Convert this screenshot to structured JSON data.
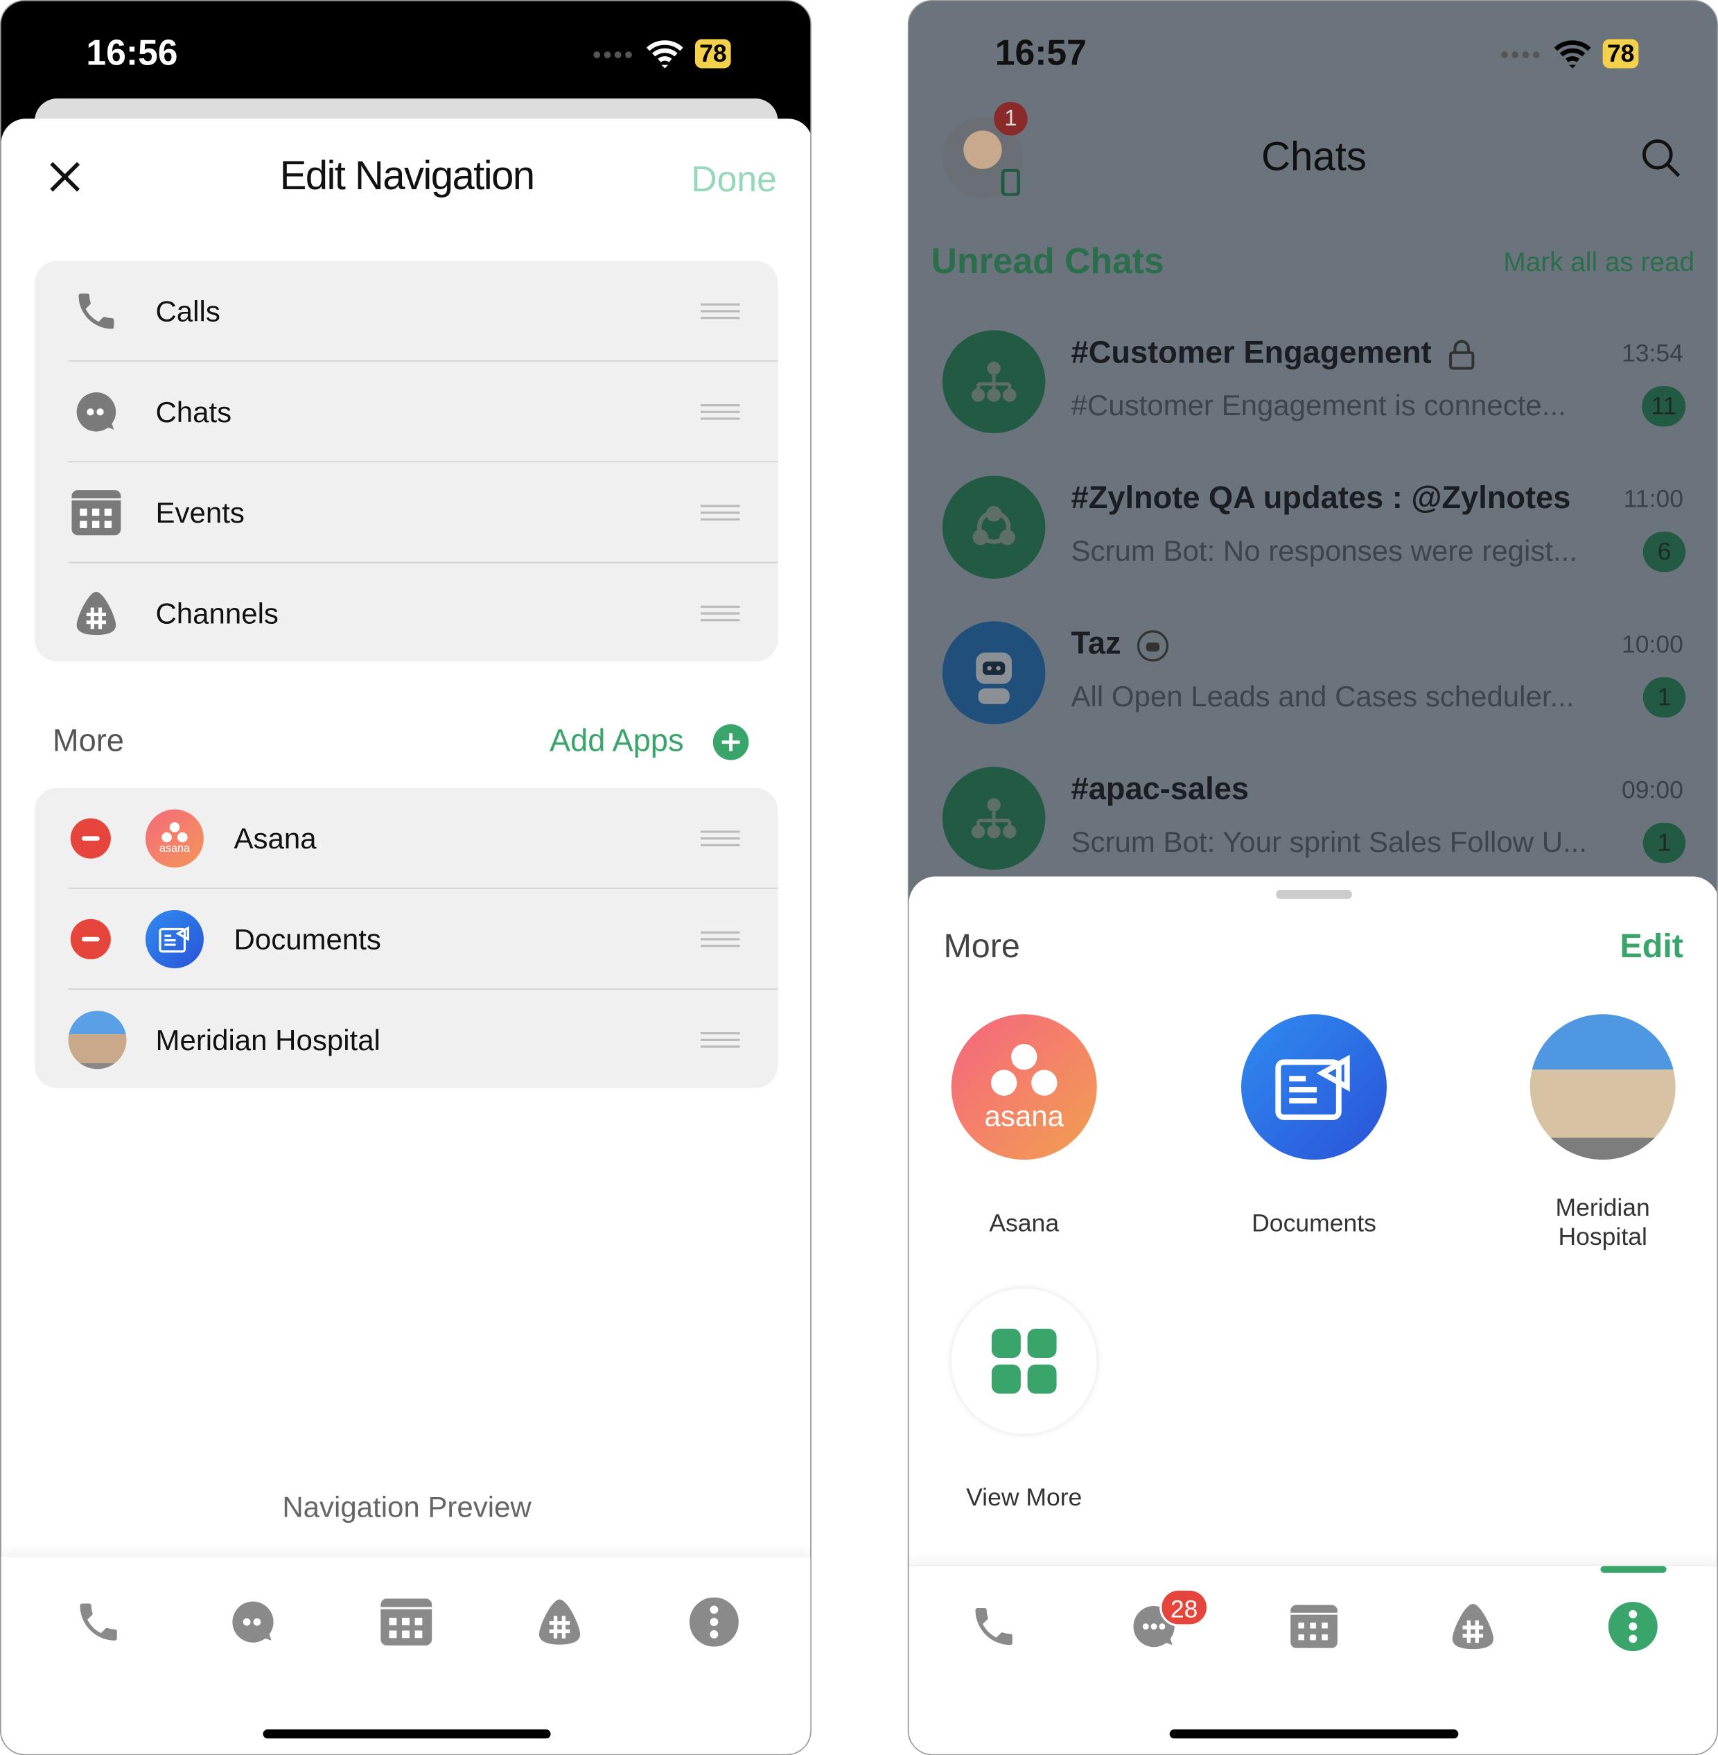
{
  "left": {
    "status": {
      "time": "16:56",
      "battery": "78"
    },
    "header": {
      "title": "Edit Navigation",
      "done": "Done"
    },
    "nav_items": [
      {
        "label": "Calls",
        "icon": "phone-icon"
      },
      {
        "label": "Chats",
        "icon": "chat-icon"
      },
      {
        "label": "Events",
        "icon": "calendar-icon"
      },
      {
        "label": "Channels",
        "icon": "channel-hash-icon"
      }
    ],
    "more": {
      "label": "More",
      "add_apps": "Add Apps",
      "items": [
        {
          "label": "Asana",
          "removable": true,
          "logo_text": "asana"
        },
        {
          "label": "Documents",
          "removable": true
        },
        {
          "label": "Meridian Hospital",
          "removable": false
        }
      ]
    },
    "preview_label": "Navigation Preview"
  },
  "right": {
    "status": {
      "time": "16:57",
      "battery": "78"
    },
    "header": {
      "title": "Chats",
      "avatar_badge": "1"
    },
    "section": {
      "title": "Unread Chats",
      "action": "Mark all as read"
    },
    "chats": [
      {
        "title": "#Customer Engagement",
        "time": "13:54",
        "preview": "#Customer Engagement is connecte...",
        "badge": "11",
        "icon": "org-icon",
        "locked": true
      },
      {
        "title": "#Zylnote QA updates : @Zylnotes",
        "time": "11:00",
        "preview": "Scrum Bot: No responses were regist...",
        "badge": "6",
        "icon": "share-network-icon"
      },
      {
        "title": "Taz",
        "time": "10:00",
        "preview": "All Open Leads and Cases scheduler...",
        "badge": "1",
        "icon": "bot-icon",
        "bot": true
      },
      {
        "title": "#apac-sales",
        "time": "09:00",
        "preview": "Scrum Bot: Your sprint Sales Follow U...",
        "badge": "1",
        "icon": "org-icon"
      }
    ],
    "more_sheet": {
      "title": "More",
      "edit": "Edit",
      "apps": [
        {
          "label": "Asana",
          "logo_text": "asana"
        },
        {
          "label": "Documents"
        },
        {
          "label": "Meridian Hospital"
        },
        {
          "label": "View More"
        }
      ]
    },
    "tabbar": {
      "chats_badge": "28",
      "active": "more"
    }
  },
  "colors": {
    "accent": "#3aa56a",
    "done_disabled": "#96d9b8",
    "remove": "#e5453b",
    "icon_grey": "#7a7a7a"
  }
}
